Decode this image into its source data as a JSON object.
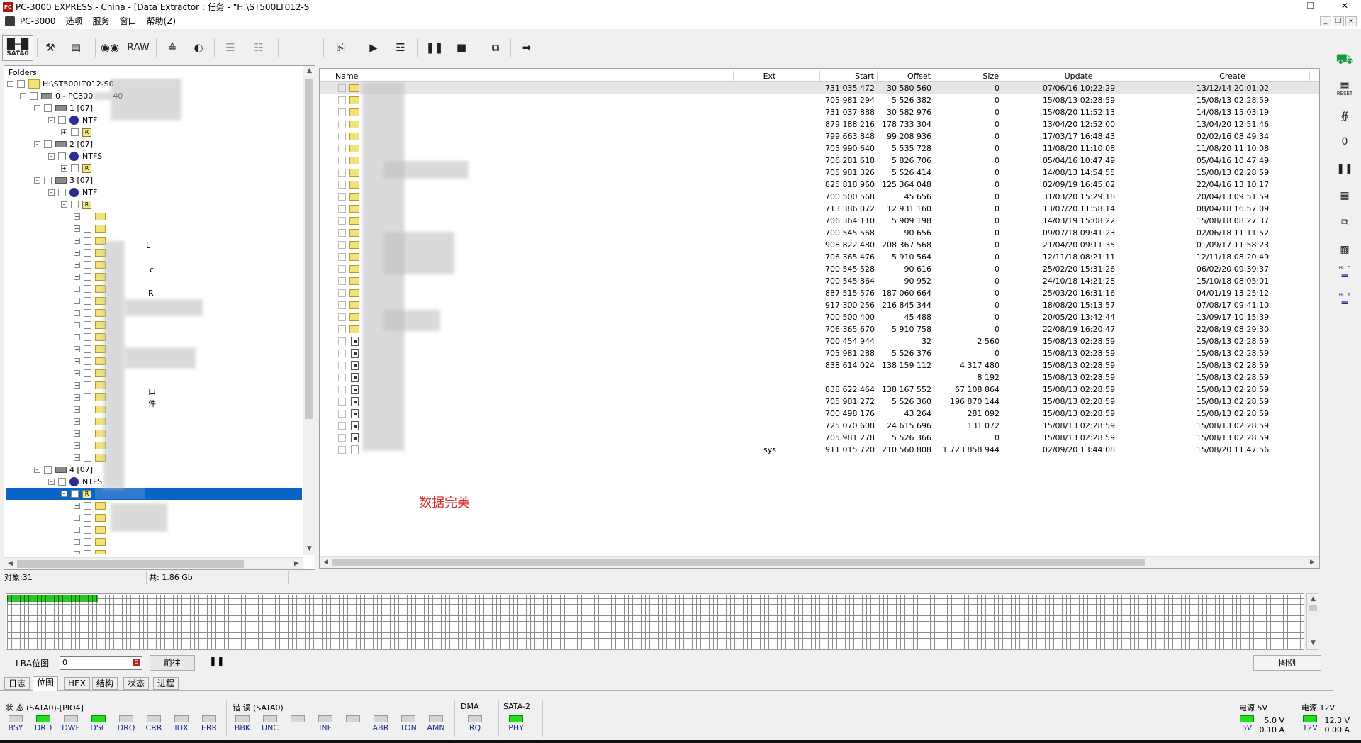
{
  "window": {
    "title": "PC-3000 EXPRESS - China - [Data Extractor : 任务 - \"H:\\ST500LT012-S",
    "minimize_icon": "minimize-icon",
    "maximize_icon": "restore-icon",
    "close_icon": "close-icon"
  },
  "menu": {
    "items": [
      "PC-3000",
      "选项",
      "服务",
      "窗口",
      "帮助(Z)"
    ]
  },
  "toolbar": {
    "sata0_label": "SATA0",
    "raw_label": "RAW"
  },
  "rightbar": {
    "reset_label": "RESET",
    "hd0_label": "Hd 0",
    "hd1_label": "Hd 1"
  },
  "folders": {
    "label": "Folders",
    "root": "H:\\ST500LT012-S0",
    "device": "0 - PC300",
    "device_suffix": "40",
    "partitions": [
      {
        "label": "1 [07]",
        "fs": "NTF"
      },
      {
        "label": "2 [07]",
        "fs": "NTFS"
      },
      {
        "label": "3 [07]",
        "fs": "NTF"
      },
      {
        "label": "4 [07]",
        "fs": "NTFS"
      }
    ],
    "root_dir_label": "R",
    "fragments": [
      "L",
      "c",
      "R",
      "口",
      "件"
    ]
  },
  "grid": {
    "columns": [
      "Name",
      "Ext",
      "Start",
      "Offset",
      "Size",
      "Update",
      "Create"
    ],
    "rows": [
      {
        "type": "folder",
        "ext": "",
        "start": "731 035 472",
        "offset": "30 580 560",
        "size": "0",
        "update": "07/06/16 10:22:29",
        "create": "13/12/14 20:01:02"
      },
      {
        "type": "folder",
        "ext": "",
        "start": "705 981 294",
        "offset": "5 526 382",
        "size": "0",
        "update": "15/08/13 02:28:59",
        "create": "15/08/13 02:28:59"
      },
      {
        "type": "folder",
        "ext": "",
        "start": "731 037 888",
        "offset": "30 582 976",
        "size": "0",
        "update": "15/08/20 11:52:13",
        "create": "14/08/13 15:03:19"
      },
      {
        "type": "folder",
        "ext": "",
        "start": "879 188 216",
        "offset": "178 733 304",
        "size": "0",
        "update": "13/04/20 12:52:00",
        "create": "13/04/20 12:51:46"
      },
      {
        "type": "folder",
        "ext": "",
        "start": "799 663 848",
        "offset": "99 208 936",
        "size": "0",
        "update": "17/03/17 16:48:43",
        "create": "02/02/16 08:49:34"
      },
      {
        "type": "folder",
        "ext": "",
        "start": "705 990 640",
        "offset": "5 535 728",
        "size": "0",
        "update": "11/08/20 11:10:08",
        "create": "11/08/20 11:10:08"
      },
      {
        "type": "folder",
        "ext": "",
        "start": "706 281 618",
        "offset": "5 826 706",
        "size": "0",
        "update": "05/04/16 10:47:49",
        "create": "05/04/16 10:47:49"
      },
      {
        "type": "folder",
        "ext": "",
        "start": "705 981 326",
        "offset": "5 526 414",
        "size": "0",
        "update": "14/08/13 14:54:55",
        "create": "15/08/13 02:28:59"
      },
      {
        "type": "folder",
        "ext": "",
        "start": "825 818 960",
        "offset": "125 364 048",
        "size": "0",
        "update": "02/09/19 16:45:02",
        "create": "22/04/16 13:10:17"
      },
      {
        "type": "folder",
        "ext": "",
        "start": "700 500 568",
        "offset": "45 656",
        "size": "0",
        "update": "31/03/20 15:29:18",
        "create": "20/04/13 09:51:59"
      },
      {
        "type": "folder",
        "ext": "",
        "start": "713 386 072",
        "offset": "12 931 160",
        "size": "0",
        "update": "13/07/20 11:58:14",
        "create": "08/04/18 16:57:09"
      },
      {
        "type": "folder",
        "ext": "",
        "start": "706 364 110",
        "offset": "5 909 198",
        "size": "0",
        "update": "14/03/19 15:08:22",
        "create": "15/08/18 08:27:37"
      },
      {
        "type": "folder",
        "ext": "",
        "start": "700 545 568",
        "offset": "90 656",
        "size": "0",
        "update": "09/07/18 09:41:23",
        "create": "02/06/18 11:11:52"
      },
      {
        "type": "folder",
        "ext": "",
        "start": "908 822 480",
        "offset": "208 367 568",
        "size": "0",
        "update": "21/04/20 09:11:35",
        "create": "01/09/17 11:58:23"
      },
      {
        "type": "folder",
        "ext": "",
        "start": "706 365 476",
        "offset": "5 910 564",
        "size": "0",
        "update": "12/11/18 08:21:11",
        "create": "12/11/18 08:20:49"
      },
      {
        "type": "folder",
        "ext": "",
        "start": "700 545 528",
        "offset": "90 616",
        "size": "0",
        "update": "25/02/20 15:31:26",
        "create": "06/02/20 09:39:37"
      },
      {
        "type": "folder",
        "ext": "",
        "start": "700 545 864",
        "offset": "90 952",
        "size": "0",
        "update": "24/10/18 14:21:28",
        "create": "15/10/18 08:05:01"
      },
      {
        "type": "folder",
        "ext": "",
        "start": "887 515 576",
        "offset": "187 060 664",
        "size": "0",
        "update": "25/03/20 16:31:16",
        "create": "04/01/19 13:25:12"
      },
      {
        "type": "folder",
        "ext": "",
        "start": "917 300 256",
        "offset": "216 845 344",
        "size": "0",
        "update": "18/08/20 15:13:57",
        "create": "07/08/17 09:41:10"
      },
      {
        "type": "folder",
        "ext": "",
        "start": "700 500 400",
        "offset": "45 488",
        "size": "0",
        "update": "20/05/20 13:42:44",
        "create": "13/09/17 10:15:39"
      },
      {
        "type": "folder",
        "ext": "",
        "start": "706 365 670",
        "offset": "5 910 758",
        "size": "0",
        "update": "22/08/19 16:20:47",
        "create": "22/08/19 08:29:30"
      },
      {
        "type": "file",
        "ext": "",
        "start": "700 454 944",
        "offset": "32",
        "size": "2 560",
        "update": "15/08/13 02:28:59",
        "create": "15/08/13 02:28:59"
      },
      {
        "type": "file",
        "ext": "",
        "start": "705 981 288",
        "offset": "5 526 376",
        "size": "0",
        "update": "15/08/13 02:28:59",
        "create": "15/08/13 02:28:59"
      },
      {
        "type": "file",
        "ext": "",
        "start": "838 614 024",
        "offset": "138 159 112",
        "size": "4 317 480",
        "update": "15/08/13 02:28:59",
        "create": "15/08/13 02:28:59"
      },
      {
        "type": "file",
        "ext": "",
        "start": "",
        "offset": "",
        "size": "8 192",
        "update": "15/08/13 02:28:59",
        "create": "15/08/13 02:28:59"
      },
      {
        "type": "file",
        "ext": "",
        "start": "838 622 464",
        "offset": "138 167 552",
        "size": "67 108 864",
        "update": "15/08/13 02:28:59",
        "create": "15/08/13 02:28:59"
      },
      {
        "type": "file",
        "ext": "",
        "start": "705 981 272",
        "offset": "5 526 360",
        "size": "196 870 144",
        "update": "15/08/13 02:28:59",
        "create": "15/08/13 02:28:59"
      },
      {
        "type": "file",
        "ext": "",
        "start": "700 498 176",
        "offset": "43 264",
        "size": "281 092",
        "update": "15/08/13 02:28:59",
        "create": "15/08/13 02:28:59"
      },
      {
        "type": "file",
        "ext": "",
        "start": "725 070 608",
        "offset": "24 615 696",
        "size": "131 072",
        "update": "15/08/13 02:28:59",
        "create": "15/08/13 02:28:59"
      },
      {
        "type": "file",
        "ext": "",
        "start": "705 981 278",
        "offset": "5 526 366",
        "size": "0",
        "update": "15/08/13 02:28:59",
        "create": "15/08/13 02:28:59"
      },
      {
        "type": "sys",
        "ext": "sys",
        "start": "911 015 720",
        "offset": "210 560 808",
        "size": "1 723 858 944",
        "update": "02/09/20 13:44:08",
        "create": "15/08/20 11:47:56"
      }
    ],
    "note": "数据完美"
  },
  "status": {
    "objects": "对象:31",
    "total": "共: 1.86 Gb"
  },
  "bitmap": {
    "progress": 0.07
  },
  "lba": {
    "label": "LBA位图",
    "value": "0",
    "go_label": "前往",
    "pause_icon": "pause-icon",
    "legend_label": "图例"
  },
  "tabs": [
    "日志",
    "位图",
    "HEX",
    "结构",
    "状态",
    "进程"
  ],
  "active_tab": "位图",
  "indicators": {
    "state_title": "状 态 (SATA0)-[PIO4]",
    "state_leds": [
      {
        "label": "BSY",
        "on": false
      },
      {
        "label": "DRD",
        "on": true
      },
      {
        "label": "DWF",
        "on": false
      },
      {
        "label": "DSC",
        "on": true
      },
      {
        "label": "DRQ",
        "on": false
      },
      {
        "label": "CRR",
        "on": false
      },
      {
        "label": "IDX",
        "on": false
      },
      {
        "label": "ERR",
        "on": false
      }
    ],
    "error_title": "错 误 (SATA0)",
    "error_leds": [
      {
        "label": "BBK",
        "on": false
      },
      {
        "label": "UNC",
        "on": false
      },
      {
        "label": "",
        "on": false
      },
      {
        "label": "INF",
        "on": false
      },
      {
        "label": "",
        "on": false
      },
      {
        "label": "ABR",
        "on": false
      },
      {
        "label": "TON",
        "on": false
      },
      {
        "label": "AMN",
        "on": false
      }
    ],
    "dma_title": "DMA",
    "dma_led": {
      "label": "RQ",
      "on": false
    },
    "sata_title": "SATA-2",
    "sata_led": {
      "label": "PHY",
      "on": true
    },
    "power5_title": "电源 5V",
    "power5_label": "5V",
    "power5_voltage": "5.0 V",
    "power5_current": "0.10 A",
    "power12_title": "电源 12V",
    "power12_label": "12V",
    "power12_voltage": "12.3 V",
    "power12_current": "0.00 A"
  },
  "colors": {
    "selection": "#0a64c8",
    "led_on": "#22e01e",
    "note": "#d0302a"
  }
}
